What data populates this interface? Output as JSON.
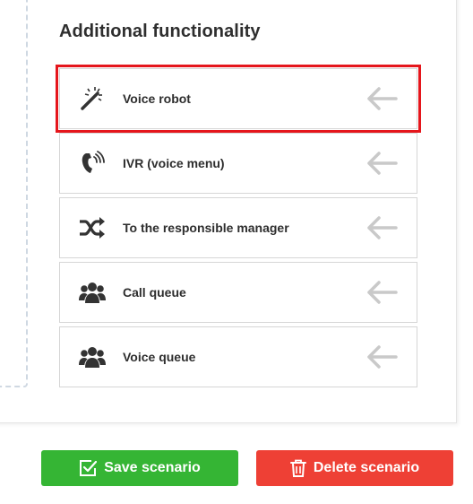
{
  "section": {
    "title": "Additional functionality"
  },
  "items": [
    {
      "label": "Voice robot",
      "icon": "magic-wand-icon",
      "highlighted": true
    },
    {
      "label": "IVR (voice menu)",
      "icon": "phone-volume-icon",
      "highlighted": false
    },
    {
      "label": "To the responsible manager",
      "icon": "shuffle-icon",
      "highlighted": false
    },
    {
      "label": "Call queue",
      "icon": "users-icon",
      "highlighted": false
    },
    {
      "label": "Voice queue",
      "icon": "users-icon",
      "highlighted": false
    }
  ],
  "actions": {
    "save_label": "Save scenario",
    "delete_label": "Delete scenario"
  },
  "colors": {
    "save": "#35b534",
    "delete": "#ee4035",
    "highlight": "#e5161c",
    "arrow": "#c9c9c9",
    "icon": "#333333"
  }
}
